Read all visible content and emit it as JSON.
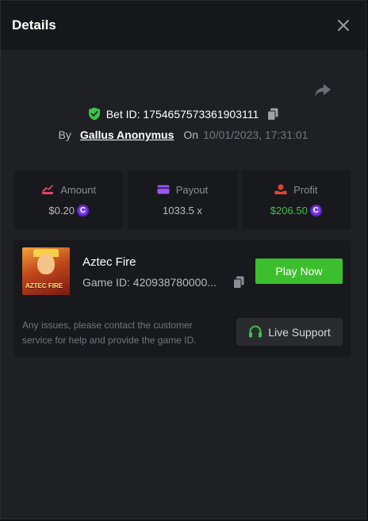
{
  "header": {
    "title": "Details"
  },
  "bet": {
    "label": "Bet ID: 1754657573361903111",
    "by_label": "By",
    "user": "Gallus Anonymus",
    "on_label": "On",
    "date": "10/01/2023, 17:31:01"
  },
  "stats": {
    "amount": {
      "label": "Amount",
      "value": "$0.20",
      "icon": "amount-icon"
    },
    "payout": {
      "label": "Payout",
      "value": "1033.5 x",
      "icon": "card-icon"
    },
    "profit": {
      "label": "Profit",
      "value": "$206.50",
      "icon": "profit-icon"
    }
  },
  "game": {
    "title": "Aztec Fire",
    "id_text": "Game ID: 420938780000...",
    "play_label": "Play Now",
    "thumb_text": "AZTEC FIRE"
  },
  "support": {
    "notice": "Any issues, please contact the customer service for help and provide the game ID.",
    "button_label": "Live Support"
  },
  "colors": {
    "accent_green": "#3bbf2e",
    "profit_green": "#3bc24a",
    "coin_purple": "#7b3df0",
    "icon_pink": "#e0456e",
    "payout_purple": "#9b59f0",
    "profit_red": "#e0453a"
  }
}
